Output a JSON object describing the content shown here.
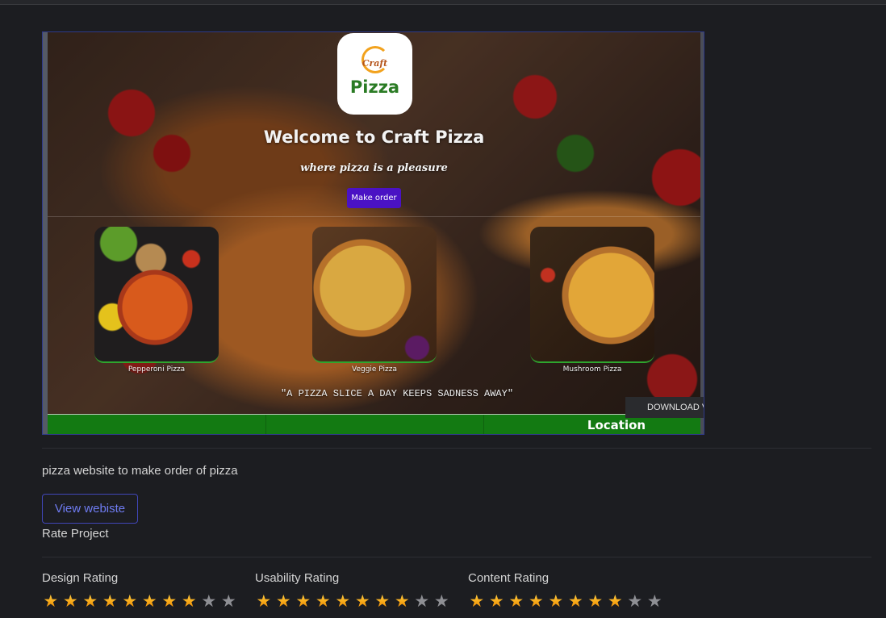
{
  "preview": {
    "logo_craft": "Craft",
    "logo_pizza": "Pizza",
    "welcome": "Welcome to Craft Pizza",
    "tagline": "where pizza is a pleasure",
    "make_order": "Make order",
    "cards": [
      {
        "label": "Pepperoni Pizza"
      },
      {
        "label": "Veggie Pizza"
      },
      {
        "label": "Mushroom Pizza"
      }
    ],
    "quote": "\"A PIZZA SLICE A DAY KEEPS SADNESS AWAY\"",
    "footer_location": "Location",
    "download_label": "DOWNLOAD V"
  },
  "description": "pizza website to make order of pizza",
  "view_button": "View webiste",
  "rate_title": "Rate Project",
  "ratings": [
    {
      "label": "Design Rating",
      "value": 8,
      "max": 10
    },
    {
      "label": "Usability Rating",
      "value": 8,
      "max": 10
    },
    {
      "label": "Content Rating",
      "value": 8,
      "max": 10
    }
  ],
  "colors": {
    "page_bg": "#1c1d21",
    "accent_button": "#6f7cf2",
    "make_order_bg": "#4a12c4",
    "footer_green": "#137a12",
    "star_on": "#f6a414",
    "star_off": "#8e8f94"
  }
}
